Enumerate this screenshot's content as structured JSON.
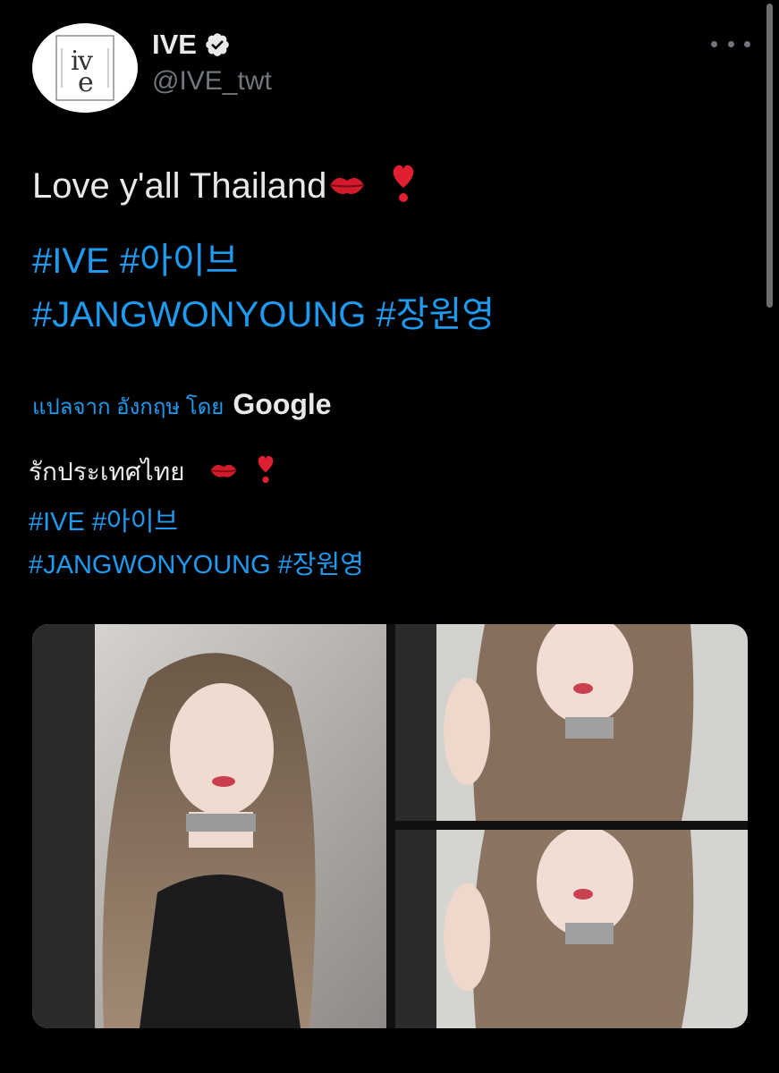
{
  "author": {
    "display_name": "IVE",
    "handle": "@IVE_twt",
    "verified": true,
    "avatar_logo": "ive-logo"
  },
  "tweet": {
    "text": "Love y'all Thailand",
    "emojis": [
      "kiss-mark-emoji",
      "heavy-exclamation-heart-emoji"
    ],
    "hashtags_line1": "#IVE #아이브",
    "hashtags_line2": "#JANGWONYOUNG #장원영"
  },
  "translation": {
    "label": "แปลจาก อังกฤษ โดย",
    "provider": "Google",
    "text": "รักประเทศไทย",
    "hashtags_line1": "#IVE #아이브",
    "hashtags_line2": "#JANGWONYOUNG #장원영"
  },
  "media": {
    "photos": [
      {
        "description": "photo-selfie-1"
      },
      {
        "description": "photo-selfie-2"
      },
      {
        "description": "photo-selfie-3"
      }
    ]
  },
  "colors": {
    "background": "#000000",
    "text": "#e7e9ea",
    "secondary": "#71767b",
    "link": "#1d9bf0",
    "verified": "#e7e9ea"
  }
}
